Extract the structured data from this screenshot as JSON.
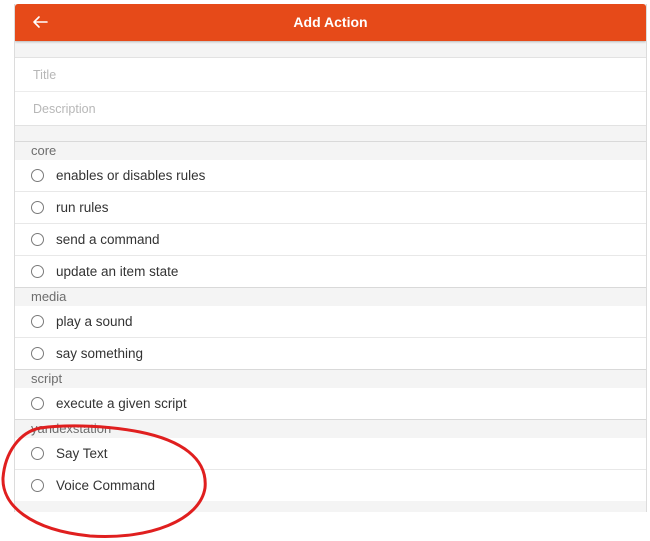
{
  "header": {
    "title": "Add Action",
    "back_icon": "arrow-left-icon",
    "color": "#e64a19"
  },
  "form": {
    "title_placeholder": "Title",
    "description_placeholder": "Description"
  },
  "groups": [
    {
      "label": "core",
      "items": [
        "enables or disables rules",
        "run rules",
        "send a command",
        "update an item state"
      ]
    },
    {
      "label": "media",
      "items": [
        "play a sound",
        "say something"
      ]
    },
    {
      "label": "script",
      "items": [
        "execute a given script"
      ]
    },
    {
      "label": "yandexstation",
      "items": [
        "Say Text",
        "Voice Command"
      ]
    }
  ],
  "annotation": {
    "color": "#e01f1f"
  }
}
